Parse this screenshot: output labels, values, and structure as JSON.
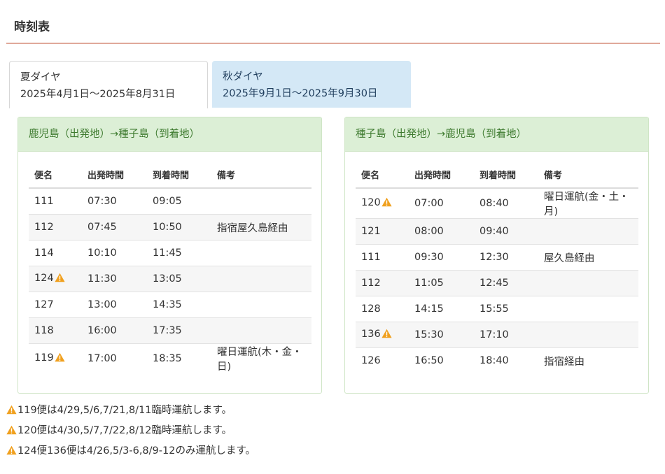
{
  "page": {
    "title": "時刻表"
  },
  "tabs": [
    {
      "name": "夏ダイヤ",
      "range": "2025年4月1日〜2025年8月31日"
    },
    {
      "name": "秋ダイヤ",
      "range": "2025年9月1日〜2025年9月30日"
    }
  ],
  "colors": {
    "warning": "#f0a01e",
    "panel_header_bg": "#dcefd6",
    "panel_header_text": "#3d7a2e",
    "active_tab_bg": "#d4e8f6",
    "title_rule": "#e0a99a"
  },
  "columns": [
    "便名",
    "出発時間",
    "到着時間",
    "備考"
  ],
  "routes": [
    {
      "heading": "鹿児島（出発地）→種子島（到着地）",
      "rows": [
        {
          "flight": "111",
          "warn": false,
          "dep": "07:30",
          "arr": "09:05",
          "note": ""
        },
        {
          "flight": "112",
          "warn": false,
          "dep": "07:45",
          "arr": "10:50",
          "note": "指宿屋久島経由"
        },
        {
          "flight": "114",
          "warn": false,
          "dep": "10:10",
          "arr": "11:45",
          "note": ""
        },
        {
          "flight": "124",
          "warn": true,
          "dep": "11:30",
          "arr": "13:05",
          "note": ""
        },
        {
          "flight": "127",
          "warn": false,
          "dep": "13:00",
          "arr": "14:35",
          "note": ""
        },
        {
          "flight": "118",
          "warn": false,
          "dep": "16:00",
          "arr": "17:35",
          "note": ""
        },
        {
          "flight": "119",
          "warn": true,
          "dep": "17:00",
          "arr": "18:35",
          "note": "曜日運航(木・金・日)"
        }
      ]
    },
    {
      "heading": "種子島（出発地）→鹿児島（到着地）",
      "rows": [
        {
          "flight": "120",
          "warn": true,
          "dep": "07:00",
          "arr": "08:40",
          "note": "曜日運航(金・土・月)"
        },
        {
          "flight": "121",
          "warn": false,
          "dep": "08:00",
          "arr": "09:40",
          "note": ""
        },
        {
          "flight": "111",
          "warn": false,
          "dep": "09:30",
          "arr": "12:30",
          "note": "屋久島経由"
        },
        {
          "flight": "112",
          "warn": false,
          "dep": "11:05",
          "arr": "12:45",
          "note": ""
        },
        {
          "flight": "128",
          "warn": false,
          "dep": "14:15",
          "arr": "15:55",
          "note": ""
        },
        {
          "flight": "136",
          "warn": true,
          "dep": "15:30",
          "arr": "17:10",
          "note": ""
        },
        {
          "flight": "126",
          "warn": false,
          "dep": "16:50",
          "arr": "18:40",
          "note": "指宿経由"
        }
      ]
    }
  ],
  "notes": [
    "119便は4/29,5/6,7/21,8/11臨時運航します。",
    "120便は4/30,5/7,7/22,8/12臨時運航します。",
    "124便136便は4/26,5/3-6,8/9-12のみ運航します。"
  ],
  "icons": {
    "warning": "warning-icon"
  }
}
